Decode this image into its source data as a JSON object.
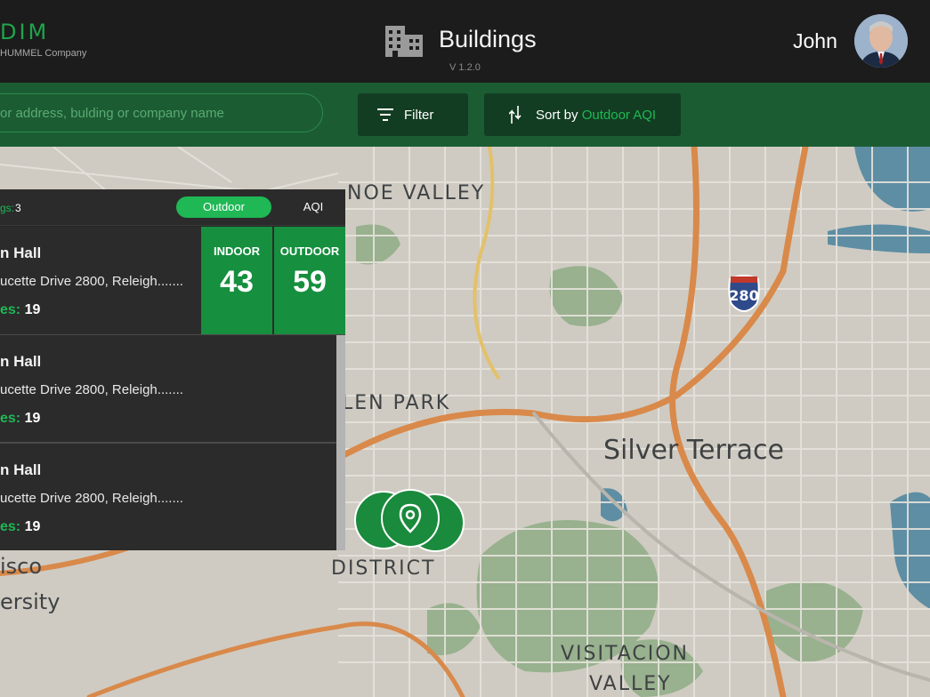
{
  "header": {
    "brand": "DIM",
    "brand_sub": "HUMMEL Company",
    "title": "Buildings",
    "version": "V 1.2.0",
    "user_name": "John"
  },
  "toolbar": {
    "search_placeholder": "or address, bulding or company name",
    "filter_label": "Filter",
    "sort_prefix": "Sort by",
    "sort_value": "Outdoor AQI"
  },
  "map": {
    "labels": [
      "NOE VALLEY",
      "LEN PARK",
      "Silver Terrace",
      "DISTRICT",
      "isco",
      "ersity",
      "VISITACION",
      "VALLEY"
    ],
    "highway_shield": "280"
  },
  "panel": {
    "count_label": "gs:",
    "count_value": "3",
    "toggle_outdoor": "Outdoor",
    "toggle_aqi": "AQI",
    "cards": [
      {
        "title": "n Hall",
        "address": "ucette Drive 2800, Releigh.......",
        "stat_label": "es:",
        "stat_value": "19",
        "indoor_label": "INDOOR",
        "indoor_value": "43",
        "outdoor_label": "OUTDOOR",
        "outdoor_value": "59"
      },
      {
        "title": "n Hall",
        "address": "ucette Drive 2800, Releigh.......",
        "stat_label": "es:",
        "stat_value": "19"
      },
      {
        "title": "n Hall",
        "address": "ucette Drive 2800, Releigh.......",
        "stat_label": "es:",
        "stat_value": "19"
      }
    ]
  },
  "colors": {
    "accent": "#1fb855",
    "toolbar_bg": "#1b5c33",
    "header_bg": "#1c1c1c",
    "aqi_box": "#168f3f"
  }
}
